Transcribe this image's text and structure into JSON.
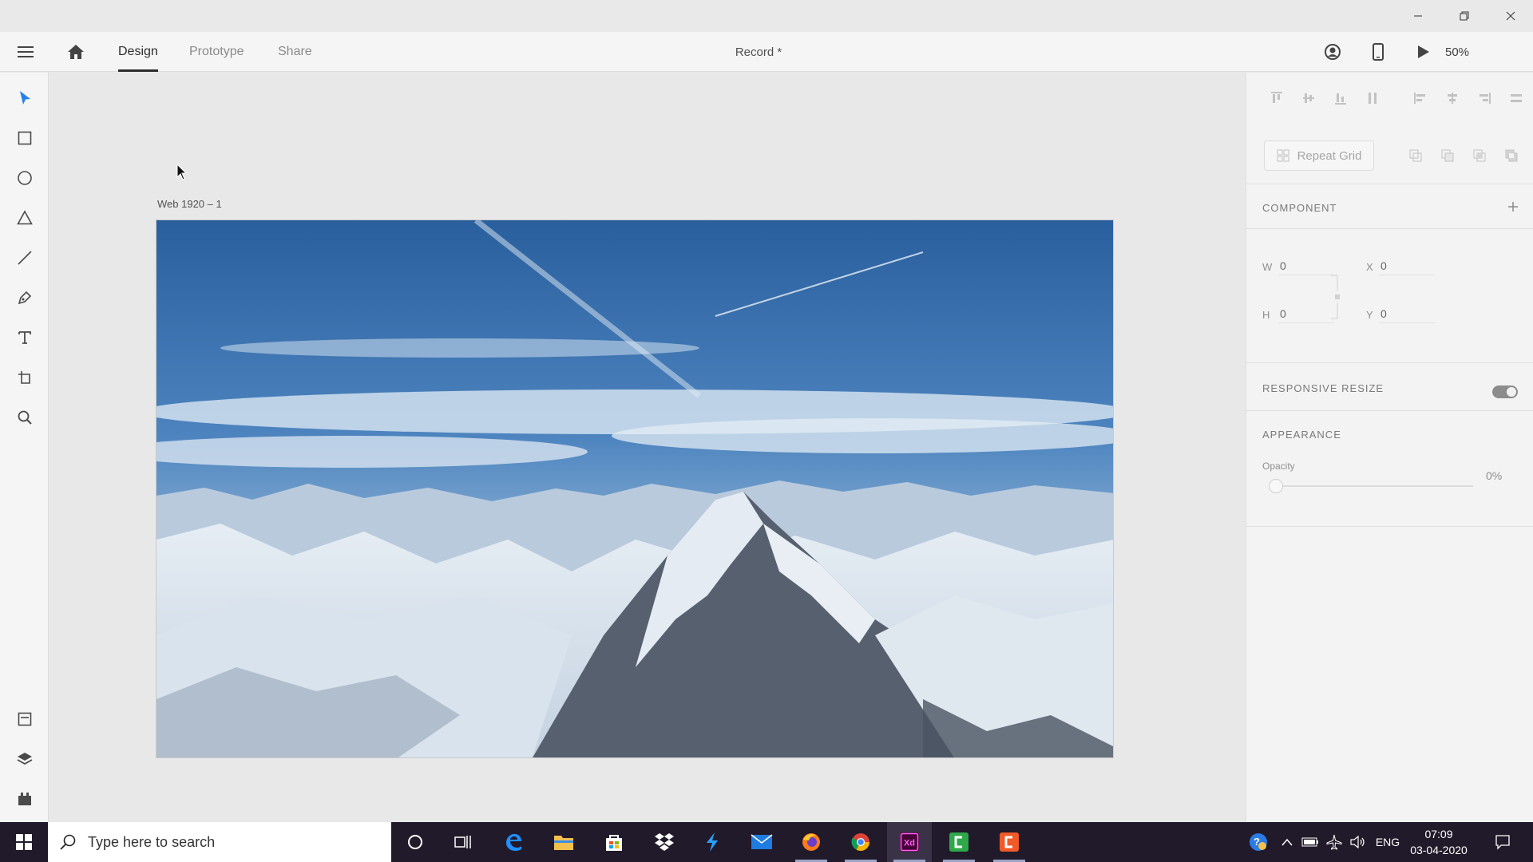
{
  "app": {
    "tabs": [
      {
        "label": "Design"
      },
      {
        "label": "Prototype"
      },
      {
        "label": "Share"
      }
    ],
    "document_title": "Record *",
    "zoom": "50%"
  },
  "canvas": {
    "artboard_label": "Web 1920 – 1"
  },
  "panel": {
    "repeat_grid_label": "Repeat Grid",
    "component_title": "COMPONENT",
    "w_label": "W",
    "w_value": "0",
    "h_label": "H",
    "h_value": "0",
    "x_label": "X",
    "x_value": "0",
    "y_label": "Y",
    "y_value": "0",
    "responsive_resize_title": "RESPONSIVE RESIZE",
    "responsive_resize_on": true,
    "appearance_title": "APPEARANCE",
    "opacity_label": "Opacity",
    "opacity_value": "0%"
  },
  "taskbar": {
    "search_placeholder": "Type here to search",
    "language": "ENG",
    "time": "07:09",
    "date": "03-04-2020"
  },
  "colors": {
    "accent": "#2680eb",
    "taskbar": "#211a2a",
    "xd_brand": "#ff61f6"
  }
}
